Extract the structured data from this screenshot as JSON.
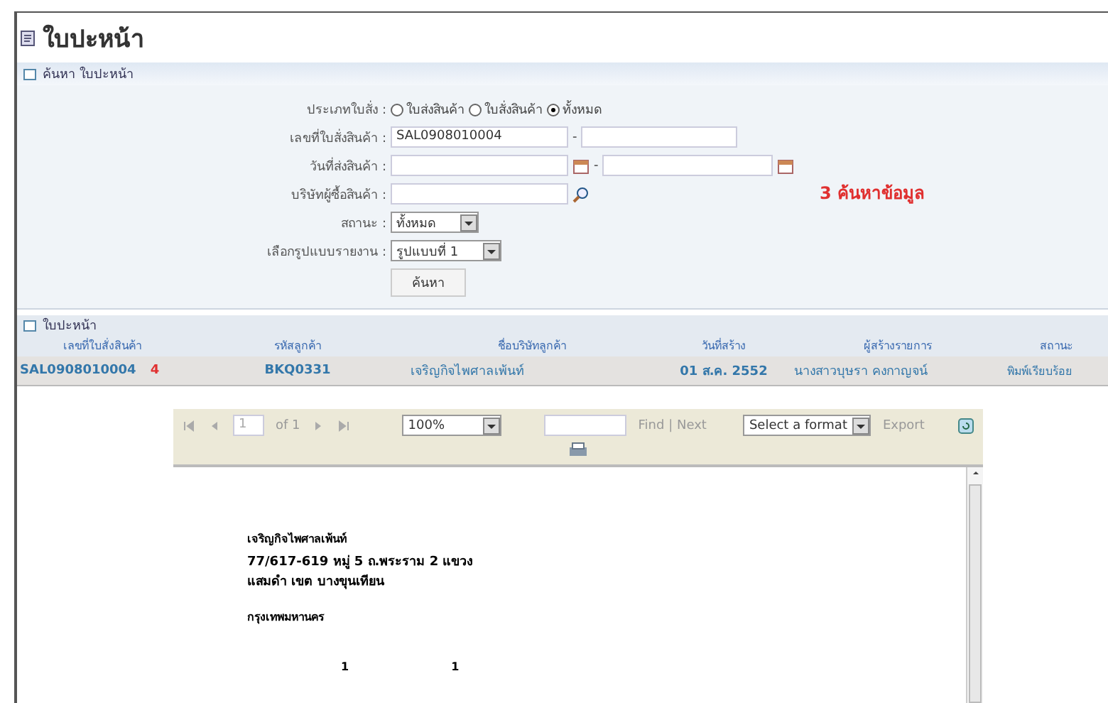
{
  "page_title": "ใบปะหน้า",
  "search_panel": {
    "title": "ค้นหา ใบปะหน้า",
    "order_type": {
      "label": "ประเภทใบสั่ง :",
      "options": [
        {
          "label": "ใบส่งสินค้า",
          "selected": false
        },
        {
          "label": "ใบสั่งสินค้า",
          "selected": false
        },
        {
          "label": "ทั้งหมด",
          "selected": true
        }
      ]
    },
    "order_no": {
      "label": "เลขที่ใบสั่งสินค้า :",
      "from": "SAL0908010004",
      "separator": "-"
    },
    "ship_date": {
      "label": "วันที่ส่งสินค้า :",
      "separator": "-"
    },
    "buyer": {
      "label": "บริษัทผู้ซื้อสินค้า :"
    },
    "status": {
      "label": "สถานะ :",
      "value": "ทั้งหมด"
    },
    "report_format": {
      "label": "เลือกรูปแบบรายงาน :",
      "value": "รูปแบบที่ 1"
    },
    "search_button": "ค้นหา",
    "note": "3 ค้นหาข้อมูล"
  },
  "results": {
    "title": "ใบปะหน้า",
    "columns": [
      "เลขที่ใบสั่งสินค้า",
      "รหัสลูกค้า",
      "ชื่อบริษัทลูกค้า",
      "วันที่สร้าง",
      "ผู้สร้างรายการ",
      "สถานะ"
    ],
    "rows": [
      {
        "order_no": "SAL0908010004",
        "marker": "4",
        "customer_code": "BKQ0331",
        "customer_name": "เจริญกิจไพศาลเพ้นท์",
        "created": "01 ส.ค. 2552",
        "creator": "นางสาวบุษรา คงกาญจน์",
        "status": "พิมพ์เรียบร้อย"
      }
    ]
  },
  "report_viewer": {
    "page": "1",
    "page_count": "of 1",
    "zoom": "100%",
    "find_next": "Find | Next",
    "format": "Select a format",
    "export": "Export",
    "lines": [
      {
        "kind": "text",
        "text": "เจริญกิจไพศาลเพ้นท์"
      },
      {
        "kind": "address",
        "text": "77/617-619 หมู่ 5 ถ.พระราม 2 แขวงแสมดำ เขต บางขุนเทียน"
      },
      {
        "kind": "text",
        "text": "กรุงเทพมหานคร"
      },
      {
        "kind": "numbers",
        "values": [
          "1",
          "1"
        ]
      }
    ]
  }
}
